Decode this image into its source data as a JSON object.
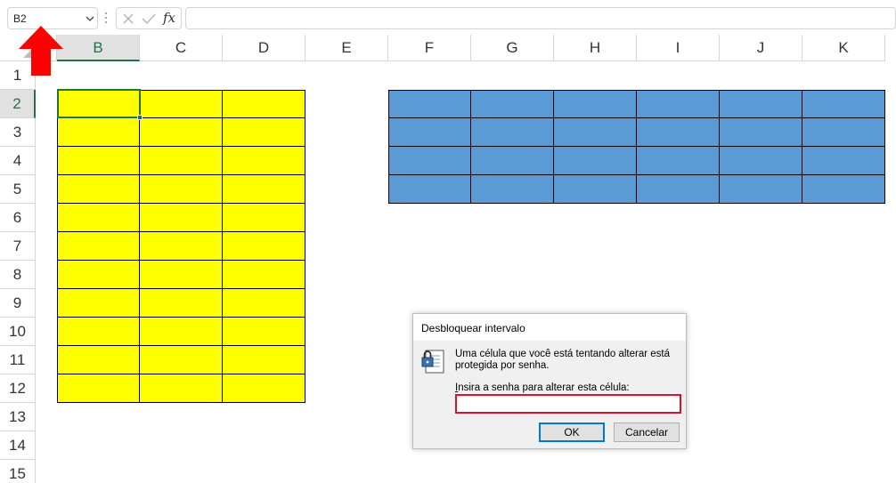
{
  "namebox": {
    "value": "B2"
  },
  "formula_bar": {
    "fx_label": "fx",
    "value": ""
  },
  "columns": [
    "B",
    "C",
    "D",
    "E",
    "F",
    "G",
    "H",
    "I",
    "J",
    "K"
  ],
  "rows": [
    "1",
    "2",
    "3",
    "4",
    "5",
    "6",
    "7",
    "8",
    "9",
    "10",
    "11",
    "12",
    "13",
    "14",
    "15"
  ],
  "selection": {
    "column": "B",
    "row": "2"
  },
  "colors": {
    "yellow_fill": "#ffff00",
    "blue_fill": "#5b9bd5",
    "excel_green": "#217346",
    "arrow_red": "#ff0000",
    "focus_red": "#e0102a"
  },
  "dialog": {
    "title": "Desbloquear intervalo",
    "message": "Uma célula que você está tentando alterar está protegida por senha.",
    "prompt_underlined": "I",
    "prompt_rest": "nsira a senha para alterar esta célula:",
    "password_value": "",
    "ok_label": "OK",
    "cancel_label": "Cancelar",
    "icon": "locked-sheet-icon"
  }
}
